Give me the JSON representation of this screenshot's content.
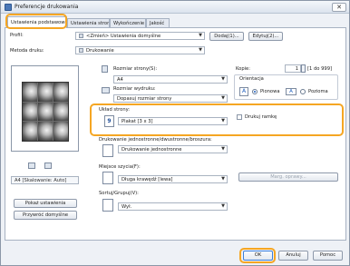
{
  "window": {
    "title": "Preferencje drukowania",
    "close_label": "✕"
  },
  "tabs": [
    {
      "label": "Ustawienia podstawowe",
      "active": true
    },
    {
      "label": "Ustawienia strony",
      "active": false
    },
    {
      "label": "Wykończenie",
      "active": false
    },
    {
      "label": "Jakość",
      "active": false
    }
  ],
  "profile": {
    "label": "Profil:",
    "value": "<Zmień> Ustawienia domyślne",
    "add_button": "Dodaj(1)...",
    "edit_button": "Edytuj(2)..."
  },
  "output_method": {
    "label": "Metoda druku:",
    "value": "Drukowanie"
  },
  "preview": {
    "status": "A4 [Skalowanie: Auto]"
  },
  "left_buttons": {
    "view_settings": "Pokaż ustawienia",
    "restore_defaults": "Przywróć domyślne"
  },
  "page_size": {
    "label": "Rozmiar strony(S):",
    "value": "A4"
  },
  "output_size": {
    "label": "Rozmiar wydruku:",
    "value": "Dopasuj rozmiar strony"
  },
  "copies": {
    "label": "Kopie:",
    "value": "1",
    "range": "[1 do 999]"
  },
  "orientation": {
    "label": "Orientacja",
    "portrait": "Pionowa",
    "landscape": "Pozioma",
    "selected": "portrait",
    "portrait_glyph": "A",
    "landscape_glyph": "A"
  },
  "page_layout": {
    "label": "Układ strony:",
    "value": "Plakat [3 x 3]",
    "glyph": "9",
    "border_label": "Drukuj ramkę"
  },
  "duplex": {
    "label": "Drukowanie jednostronne/dwustronne/broszura:",
    "value": "Drukowanie jednostronne"
  },
  "binding": {
    "label": "Miejsce szycia(F):",
    "value": "Długa krawędź [lewa]",
    "margin_button": "Marg. oprawy..."
  },
  "collate": {
    "label": "Sortuj/Grupuj(V):",
    "value": "Wył."
  },
  "footer": {
    "ok": "OK",
    "cancel": "Anuluj",
    "help": "Pomoc"
  }
}
